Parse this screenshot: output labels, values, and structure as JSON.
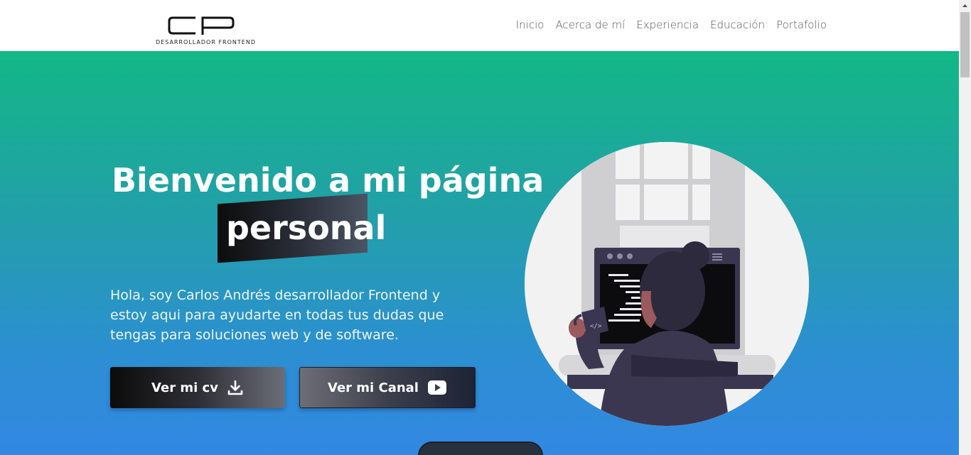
{
  "header": {
    "logo_text": "CP",
    "logo_subtitle": "DESARROLLADOR FRONTEND",
    "nav": [
      "Inicio",
      "Acerca de mí",
      "Experiencia",
      "Educación",
      "Portafolio"
    ]
  },
  "hero": {
    "title": "Bienvenido a mi página",
    "title_highlight": "personal",
    "description": "Hola, soy Carlos Andrés desarrollador Frontend y estoy aqui para ayudarte en todas tus dudas que tengas para soluciones web y de software.",
    "buttons": {
      "cv": "Ver mi cv",
      "canal": "Ver mi Canal"
    }
  },
  "colors": {
    "gradient_top": "#12b886",
    "gradient_bottom": "#3388e2"
  }
}
